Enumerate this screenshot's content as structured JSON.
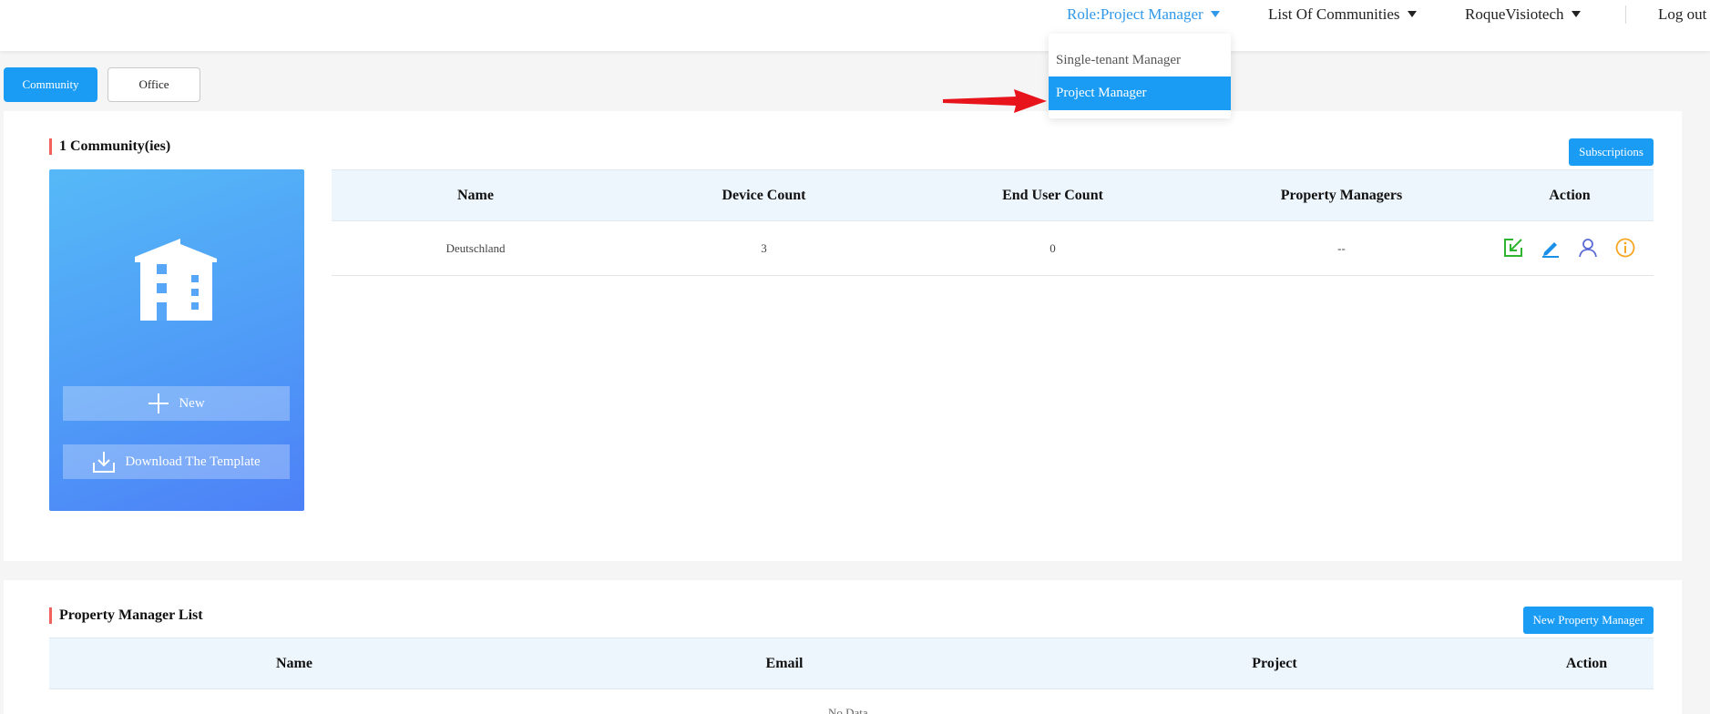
{
  "header": {
    "role_label": "Role:Project Manager",
    "communities_label": "List Of Communities",
    "user_label": "RoqueVisiotech",
    "logout_label": "Log out",
    "accent_color": "#2f98e8"
  },
  "role_dropdown": {
    "items": [
      {
        "label": "Single-tenant Manager",
        "selected": false
      },
      {
        "label": "Project Manager",
        "selected": true
      }
    ]
  },
  "tabs": [
    {
      "label": "Community",
      "active": true
    },
    {
      "label": "Office",
      "active": false
    }
  ],
  "community_section": {
    "title": "1 Community(ies)",
    "subscriptions_label": "Subscriptions",
    "card": {
      "icon": "building-icon",
      "new_label": "New",
      "download_label": "Download The Template"
    },
    "table": {
      "columns": [
        "Name",
        "Device Count",
        "End User Count",
        "Property Managers",
        "Action"
      ],
      "rows": [
        {
          "name": "Deutschland",
          "device_count": "3",
          "end_user_count": "0",
          "property_managers": "--",
          "actions": [
            "enter-icon",
            "edit-icon",
            "user-icon",
            "info-icon"
          ]
        }
      ]
    }
  },
  "property_manager_section": {
    "title": "Property Manager List",
    "new_button_label": "New Property Manager",
    "table": {
      "columns": [
        "Name",
        "Email",
        "Project",
        "Action"
      ],
      "empty_text": "No Data"
    }
  },
  "colors": {
    "primary": "#1a9cf5",
    "title_marker": "#f2615b",
    "annotation_arrow": "#e8141c",
    "action_enter": "#2fb52f",
    "action_edit": "#1a8fe8",
    "action_user": "#5a6bd6",
    "action_info": "#f5a623"
  }
}
